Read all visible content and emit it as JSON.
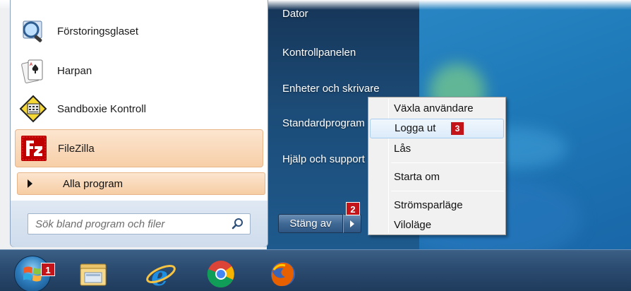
{
  "programs": [
    {
      "label": "Förstoringsglaset",
      "icon": "magnifier-app-icon"
    },
    {
      "label": "Harpan",
      "icon": "solitaire-cards-icon"
    },
    {
      "label": "Sandboxie Kontroll",
      "icon": "sandboxie-icon"
    },
    {
      "label": "FileZilla",
      "icon": "filezilla-icon"
    }
  ],
  "all_programs": {
    "label": "Alla program"
  },
  "search": {
    "placeholder": "Sök bland program och filer"
  },
  "right_links": {
    "dator": "Dator",
    "kontrollpanelen": "Kontrollpanelen",
    "enheter": "Enheter och skrivare",
    "standardprogram": "Standardprogram",
    "hjalp": "Hjälp och support"
  },
  "shutdown": {
    "label": "Stäng av"
  },
  "context_menu": {
    "items": [
      "Växla användare",
      "Logga ut",
      "Lås",
      "Starta om",
      "Strömsparläge",
      "Viloläge"
    ],
    "highlighted": "Logga ut"
  },
  "badges": {
    "start": "1",
    "arrow": "2",
    "logout": "3"
  },
  "taskbar": {
    "icons": [
      "windows-start-orb-icon",
      "file-explorer-icon",
      "internet-explorer-icon",
      "chrome-icon",
      "firefox-icon"
    ]
  },
  "colors": {
    "highlight_orange": "#f7cfa8",
    "badge_red": "#c3141a",
    "menu_highlight": "#dcebfa",
    "taskbar": "#2b4b70"
  }
}
